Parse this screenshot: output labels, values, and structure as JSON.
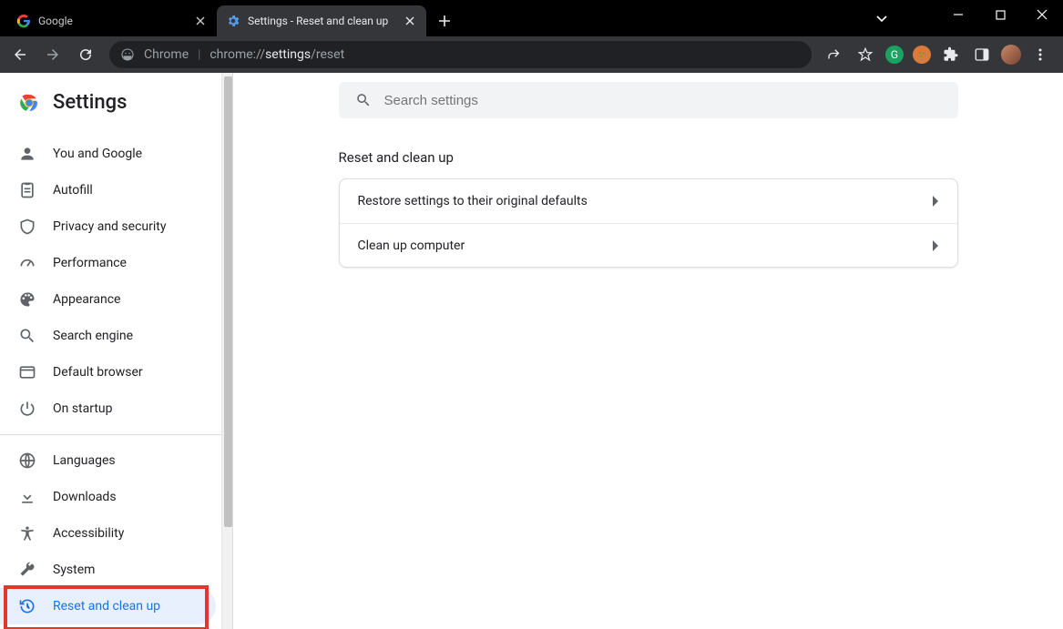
{
  "window": {
    "tabs": [
      {
        "title": "Google",
        "active": false
      },
      {
        "title": "Settings - Reset and clean up",
        "active": true
      }
    ]
  },
  "toolbar": {
    "chrome_label": "Chrome",
    "url_prefix": "chrome://",
    "url_path_bold": "settings",
    "url_path_rest": "/reset"
  },
  "settings": {
    "title": "Settings",
    "search_placeholder": "Search settings",
    "nav_groups": [
      [
        {
          "id": "you-and-google",
          "label": "You and Google",
          "icon": "person"
        },
        {
          "id": "autofill",
          "label": "Autofill",
          "icon": "autofill"
        },
        {
          "id": "privacy",
          "label": "Privacy and security",
          "icon": "shield"
        },
        {
          "id": "performance",
          "label": "Performance",
          "icon": "speed"
        },
        {
          "id": "appearance",
          "label": "Appearance",
          "icon": "palette"
        },
        {
          "id": "search-engine",
          "label": "Search engine",
          "icon": "search"
        },
        {
          "id": "default-browser",
          "label": "Default browser",
          "icon": "browser"
        },
        {
          "id": "on-startup",
          "label": "On startup",
          "icon": "power"
        }
      ],
      [
        {
          "id": "languages",
          "label": "Languages",
          "icon": "globe"
        },
        {
          "id": "downloads",
          "label": "Downloads",
          "icon": "download"
        },
        {
          "id": "accessibility",
          "label": "Accessibility",
          "icon": "accessibility"
        },
        {
          "id": "system",
          "label": "System",
          "icon": "wrench"
        },
        {
          "id": "reset",
          "label": "Reset and clean up",
          "icon": "restore",
          "selected": true
        }
      ]
    ]
  },
  "main": {
    "section_title": "Reset and clean up",
    "rows": [
      {
        "label": "Restore settings to their original defaults"
      },
      {
        "label": "Clean up computer"
      }
    ]
  }
}
